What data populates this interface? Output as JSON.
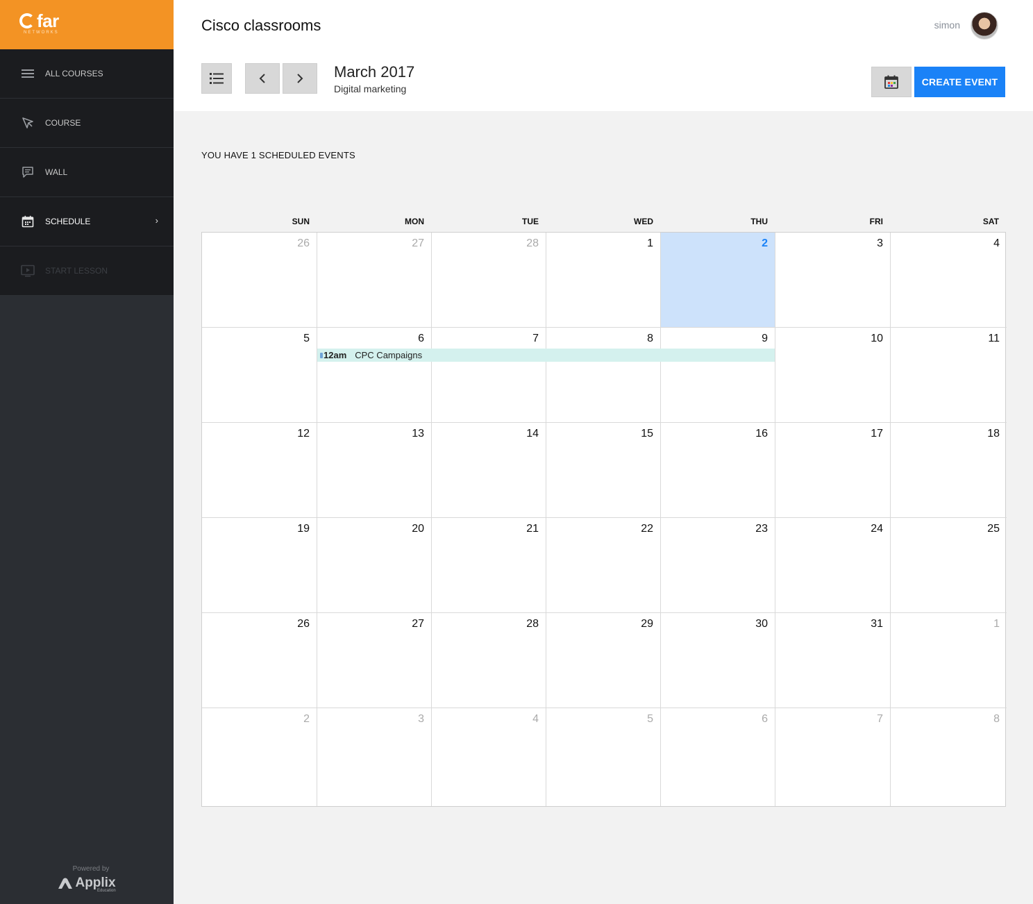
{
  "brand": {
    "logo_text": "far",
    "logo_sub": "NETWORKS"
  },
  "sidebar": {
    "items": [
      {
        "label": "ALL COURSES",
        "icon": "menu-icon"
      },
      {
        "label": "COURSE",
        "icon": "cursor-icon"
      },
      {
        "label": "WALL",
        "icon": "chat-icon"
      },
      {
        "label": "SCHEDULE",
        "icon": "calendar-icon",
        "active": true
      },
      {
        "label": "START LESSON",
        "icon": "video-icon",
        "disabled": true
      }
    ],
    "powered_by": "Powered by",
    "powered_brand": "Applix",
    "powered_sub": "Education"
  },
  "header": {
    "title": "Cisco classrooms",
    "user_name": "simon",
    "month_title": "March 2017",
    "month_subtitle": "Digital marketing",
    "create_event_label": "CREATE EVENT"
  },
  "scheduled_text": "YOU HAVE 1 SCHEDULED EVENTS",
  "calendar": {
    "days_of_week": [
      "SUN",
      "MON",
      "TUE",
      "WED",
      "THU",
      "FRI",
      "SAT"
    ],
    "days": [
      {
        "n": "26",
        "other": true
      },
      {
        "n": "27",
        "other": true
      },
      {
        "n": "28",
        "other": true
      },
      {
        "n": "1"
      },
      {
        "n": "2",
        "today": true
      },
      {
        "n": "3"
      },
      {
        "n": "4"
      },
      {
        "n": "5"
      },
      {
        "n": "6"
      },
      {
        "n": "7"
      },
      {
        "n": "8"
      },
      {
        "n": "9"
      },
      {
        "n": "10"
      },
      {
        "n": "11"
      },
      {
        "n": "12"
      },
      {
        "n": "13"
      },
      {
        "n": "14"
      },
      {
        "n": "15"
      },
      {
        "n": "16"
      },
      {
        "n": "17"
      },
      {
        "n": "18"
      },
      {
        "n": "19"
      },
      {
        "n": "20"
      },
      {
        "n": "21"
      },
      {
        "n": "22"
      },
      {
        "n": "23"
      },
      {
        "n": "24"
      },
      {
        "n": "25"
      },
      {
        "n": "26"
      },
      {
        "n": "27"
      },
      {
        "n": "28"
      },
      {
        "n": "29"
      },
      {
        "n": "30"
      },
      {
        "n": "31"
      },
      {
        "n": "1",
        "other": true
      },
      {
        "n": "2",
        "other": true
      },
      {
        "n": "3",
        "other": true
      },
      {
        "n": "4",
        "other": true
      },
      {
        "n": "5",
        "other": true
      },
      {
        "n": "6",
        "other": true
      },
      {
        "n": "7",
        "other": true
      },
      {
        "n": "8",
        "other": true
      }
    ],
    "event": {
      "time": "12am",
      "title": "CPC Campaigns",
      "color": "#d4f1ee"
    }
  },
  "colors": {
    "accent": "#1a82f7",
    "brand": "#f39324",
    "sidebar": "#2b2e33",
    "today": "#cde2fb"
  }
}
